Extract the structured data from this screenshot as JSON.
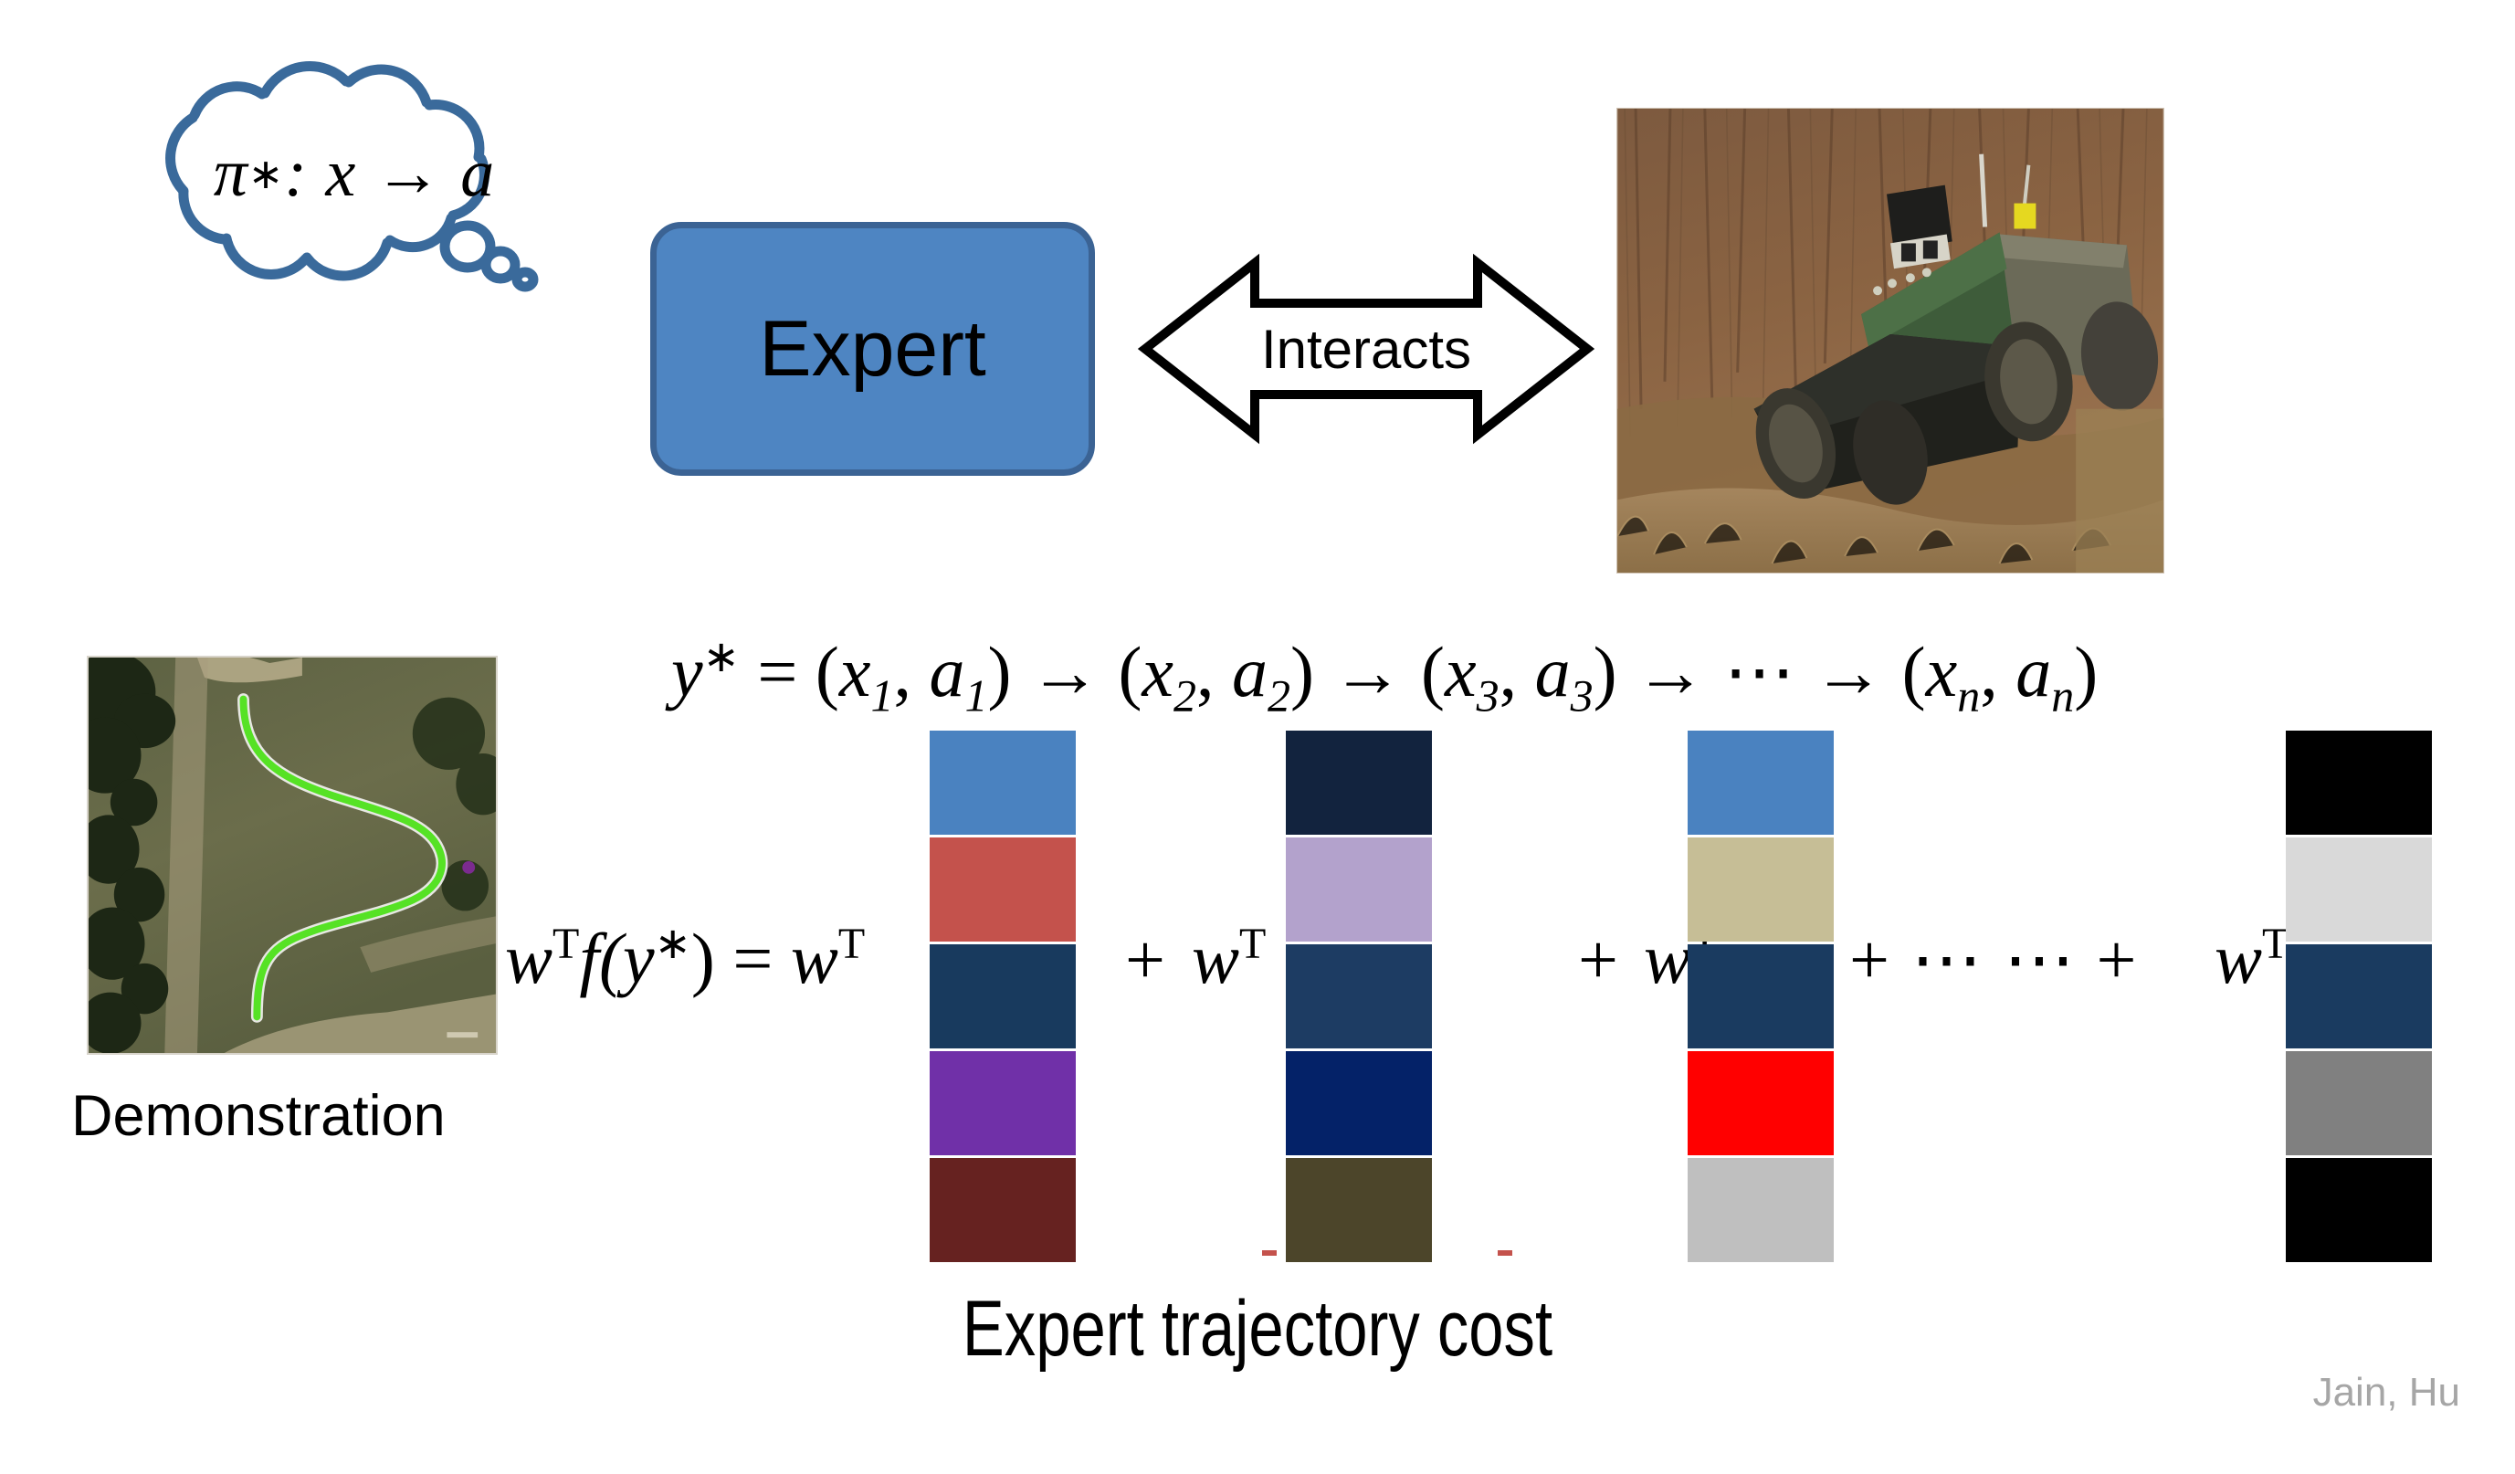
{
  "slide": {
    "bottom_caption": "Expert trajectory cost",
    "attribution": "Jain, Hu"
  },
  "thought_cloud": {
    "icon": "thought-cloud-icon",
    "policy_symbol": "π",
    "policy_star": "∗",
    "policy_mapping": ": x → a",
    "outline_color": "#3A6A9B"
  },
  "expert": {
    "label": "Expert",
    "fill_color": "#4E85C2",
    "border_color": "#3B6394"
  },
  "interacts": {
    "label": "Interacts",
    "icon": "double-headed-arrow-icon",
    "fill_color": "#FFFFFF",
    "stroke_color": "#000000"
  },
  "robot_photo": {
    "alt": "off-road robot vehicle on rocky terrain",
    "icon": "robot-vehicle-photo"
  },
  "demonstration": {
    "caption": "Demonstration",
    "alt": "aerial view of terrain with green demonstrated path",
    "icon": "aerial-trajectory-photo",
    "path_color": "#56E225"
  },
  "trajectory_equation": {
    "lhs": "y",
    "lhs_star": "∗",
    "equals": " = ",
    "steps": [
      {
        "open": "(",
        "x": "x",
        "xsub": "1",
        "comma": ", ",
        "a": "a",
        "asub": "1",
        "close": ")"
      },
      {
        "open": "(",
        "x": "x",
        "xsub": "2",
        "comma": ", ",
        "a": "a",
        "asub": "2",
        "close": ")"
      },
      {
        "open": "(",
        "x": "x",
        "xsub": "3",
        "comma": ", ",
        "a": "a",
        "asub": "3",
        "close": ")"
      },
      {
        "open": "(",
        "x": "x",
        "xsub": "n",
        "comma": ", ",
        "a": "a",
        "asub": "n",
        "close": ")"
      }
    ],
    "arrow": " → ",
    "ellipsis": "⋯",
    "full_text": "y∗ = (x1, a1) → (x2, a2) → (x3, a3) → ⋯ → (xn, an)"
  },
  "cost_equation": {
    "lhs": "w",
    "lhs_sup": "T",
    "lhs_fn": "f(y",
    "lhs_fn_star": "∗",
    "lhs_fn_close": ")",
    "equals": " = ",
    "w_term": "w",
    "w_sup": "T",
    "plus": "+",
    "ellipsis": "⋯ ⋯",
    "full_text": "wTf(y∗) = wT [ ] + wT [ ] + wT [ ] + ⋯ ⋯ + wT [ ]"
  },
  "feature_stacks": [
    {
      "name": "feature-vector-1",
      "colors": [
        "#4A82C0",
        "#C4524C",
        "#183A5E",
        "#7030A8",
        "#662220"
      ]
    },
    {
      "name": "feature-vector-2",
      "colors": [
        "#12233E",
        "#B3A2CC",
        "#1D3C63",
        "#042268",
        "#4C452A"
      ]
    },
    {
      "name": "feature-vector-3",
      "colors": [
        "#4A82C0",
        "#C6BE96",
        "#1A3B60",
        "#FF0000",
        "#BFBFBF"
      ]
    },
    {
      "name": "feature-vector-n",
      "colors": [
        "#000000",
        "#D9D9D9",
        "#1A3B60",
        "#808080",
        "#000000"
      ]
    }
  ]
}
